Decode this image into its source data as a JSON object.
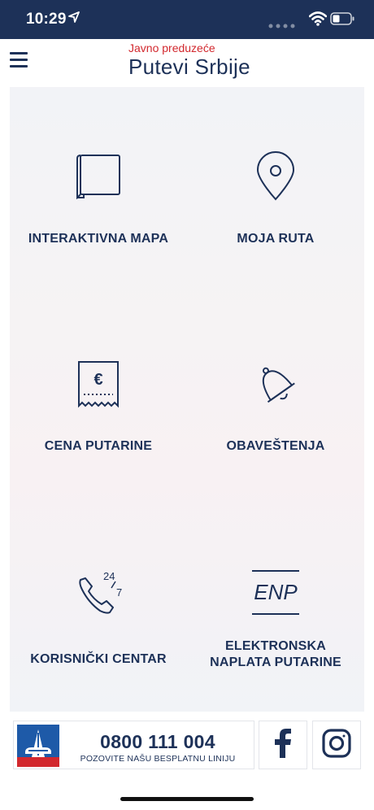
{
  "status_bar": {
    "time": "10:29"
  },
  "header": {
    "subtitle": "Javno preduzeće",
    "title": "Putevi Srbije"
  },
  "tiles": [
    {
      "label": "INTERAKTIVNA MAPA",
      "icon": "map-icon"
    },
    {
      "label": "MOJA RUTA",
      "icon": "location-pin-icon"
    },
    {
      "label": "CENA PUTARINE",
      "icon": "receipt-euro-icon"
    },
    {
      "label": "OBAVEŠTENJA",
      "icon": "bell-icon"
    },
    {
      "label": "KORISNIČKI CENTAR",
      "icon": "phone-24-7-icon"
    },
    {
      "label_line1": "ELEKTRONSKA",
      "label_line2": "NAPLATA PUTARINE",
      "icon": "enp-icon",
      "icon_text": "ENP"
    }
  ],
  "phone_icon_text": {
    "top": "24",
    "bottom": "7"
  },
  "footer": {
    "phone_number": "0800 111 004",
    "caption": "POZOVITE NAŠU BESPLATNU LINIJU",
    "facebook_icon": "facebook-icon",
    "instagram_icon": "instagram-icon"
  },
  "colors": {
    "primary": "#1d3158",
    "accent": "#d2282e",
    "background": "#f4f3f6"
  }
}
